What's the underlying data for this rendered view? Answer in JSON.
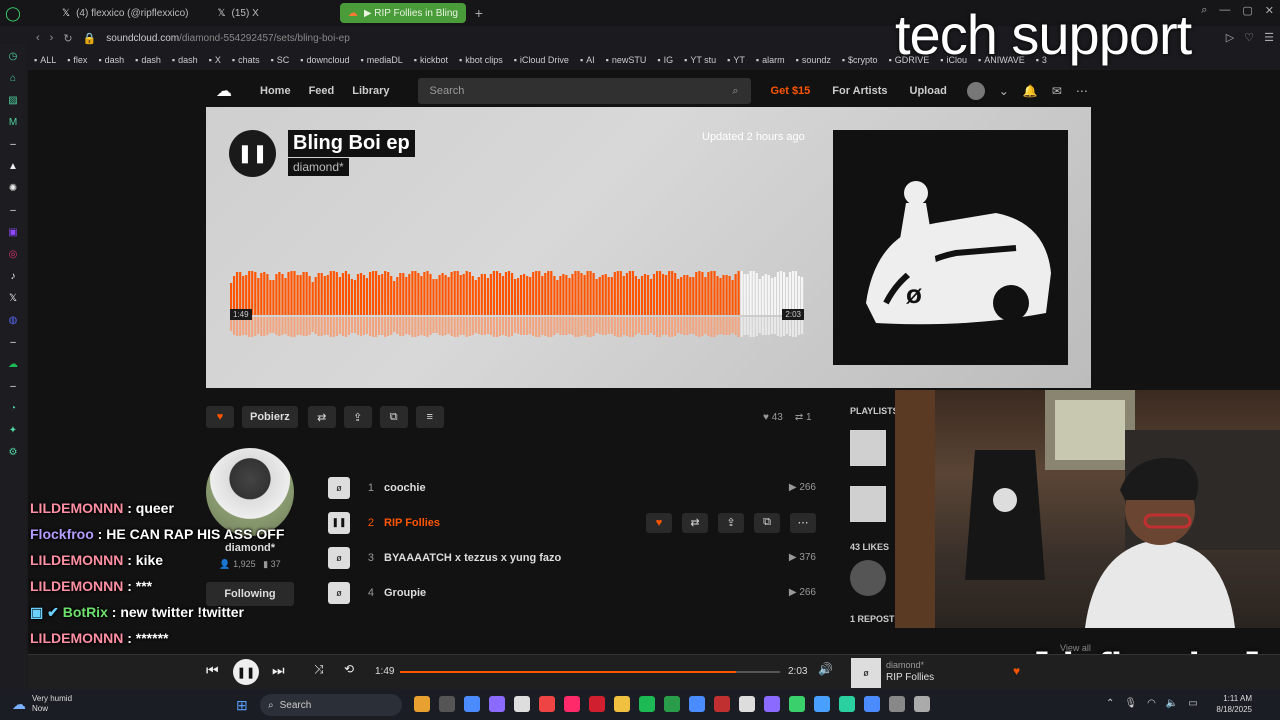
{
  "browser": {
    "tabs": [
      {
        "label": "(4) flexxico (@ripflexxico)",
        "icon": "x-icon"
      },
      {
        "label": "(15) X",
        "icon": "x-icon"
      },
      {
        "label": "▶ RIP Follies in Bling Boi",
        "icon": "soundcloud-icon",
        "active": true
      }
    ],
    "url_host": "soundcloud.com",
    "url_path": "/diamond-554292457/sets/bling-boi-ep",
    "bookmarks": [
      "ALL",
      "flex",
      "dash",
      "dash",
      "dash",
      "X",
      "chats",
      "SC",
      "downcloud",
      "mediaDL",
      "kickbot",
      "kbot clips",
      "iCloud Drive",
      "AI",
      "newSTU",
      "IG",
      "YT stu",
      "YT",
      "alarm",
      "soundz",
      "$crypto",
      "GDRIVE",
      "iClou",
      "ANIWAVE",
      "3"
    ]
  },
  "soundcloud": {
    "nav": {
      "home": "Home",
      "feed": "Feed",
      "library": "Library",
      "search_placeholder": "Search",
      "get": "Get $15",
      "for_artists": "For Artists",
      "upload": "Upload"
    },
    "hero": {
      "title": "Bling Boi ep",
      "artist": "diamond*",
      "updated": "Updated 2 hours ago",
      "time_current": "1:49",
      "time_total": "2:03",
      "progress": 0.885
    },
    "actions": {
      "download": "Pobierz",
      "likes": "43",
      "reposts": "1"
    },
    "user": {
      "name": "diamond*",
      "followers": "1,925",
      "tracks": "37",
      "follow": "Following"
    },
    "tracks": [
      {
        "num": "1",
        "title": "coochie",
        "plays": "266"
      },
      {
        "num": "2",
        "title": "RIP Follies",
        "plays": "",
        "current": true
      },
      {
        "num": "3",
        "title": "BYAAAATCH x tezzus x yung fazo",
        "plays": "376"
      },
      {
        "num": "4",
        "title": "Groupie",
        "plays": "266"
      }
    ],
    "sidebar": {
      "playlists": "PLAYLISTS",
      "likes": "43 LIKES",
      "reposts": "1 REPOST",
      "view_all": "View all"
    }
  },
  "player": {
    "time_current": "1:49",
    "time_total": "2:03",
    "progress": 0.885,
    "artist": "diamond*",
    "track": "RIP Follies"
  },
  "chat": [
    {
      "user": "LILDEMONNN",
      "msg": "queer",
      "cls": "cu"
    },
    {
      "user": "Flockfroo",
      "msg": "HE CAN RAP HIS ASS OFF",
      "cls": "cu flock"
    },
    {
      "user": "LILDEMONNN",
      "msg": "kike",
      "cls": "cu"
    },
    {
      "user": "LILDEMONNN",
      "msg": "***",
      "cls": "cu"
    },
    {
      "user": "BotRix",
      "msg": "new twitter !twitter",
      "cls": "cu bot"
    },
    {
      "user": "LILDEMONNN",
      "msg": "******",
      "cls": "cu"
    }
  ],
  "overlay": {
    "top": "tech support",
    "bottom": "[ripflexxico]"
  },
  "taskbar": {
    "weather": "Very humid",
    "weather_sub": "Now",
    "search": "Search",
    "time": "1:11 AM",
    "date": "8/18/2025"
  },
  "colors": {
    "accent": "#ff5500",
    "tab_active": "#4a9b3a"
  }
}
